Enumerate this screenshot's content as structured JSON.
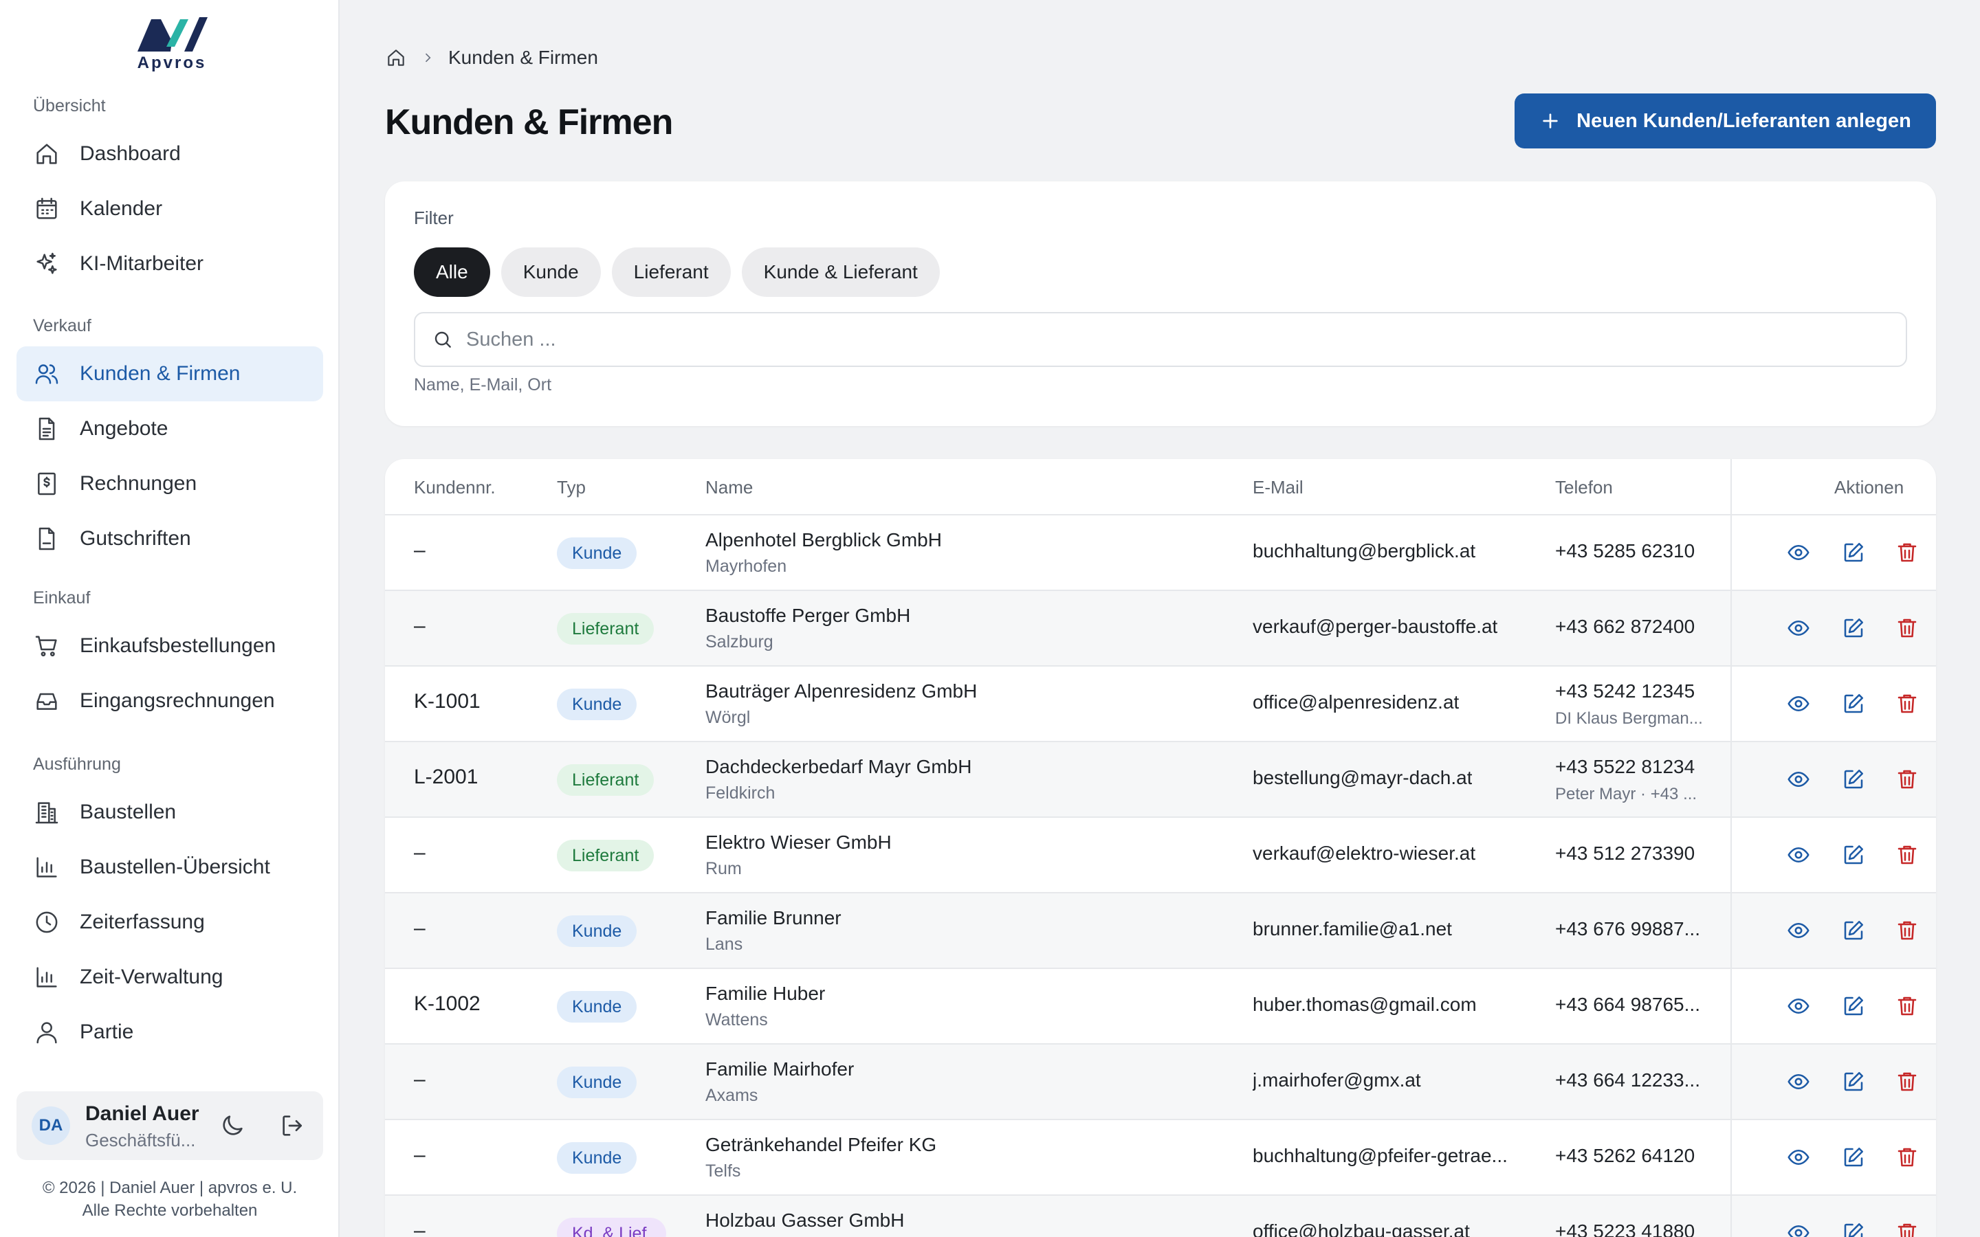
{
  "app": {
    "logo_text": "Apvros"
  },
  "sidebar": {
    "sections": [
      {
        "label": "Übersicht",
        "items": [
          {
            "label": "Dashboard",
            "icon": "home-icon"
          },
          {
            "label": "Kalender",
            "icon": "calendar-icon"
          },
          {
            "label": "KI-Mitarbeiter",
            "icon": "sparkles-icon"
          }
        ]
      },
      {
        "label": "Verkauf",
        "items": [
          {
            "label": "Kunden & Firmen",
            "icon": "users-icon",
            "active": true
          },
          {
            "label": "Angebote",
            "icon": "document-icon"
          },
          {
            "label": "Rechnungen",
            "icon": "invoice-icon"
          },
          {
            "label": "Gutschriften",
            "icon": "file-icon"
          }
        ]
      },
      {
        "label": "Einkauf",
        "items": [
          {
            "label": "Einkaufsbestellungen",
            "icon": "cart-icon"
          },
          {
            "label": "Eingangsrechnungen",
            "icon": "inbox-icon"
          }
        ]
      },
      {
        "label": "Ausführung",
        "items": [
          {
            "label": "Baustellen",
            "icon": "building-icon"
          },
          {
            "label": "Baustellen-Übersicht",
            "icon": "bar-chart-icon"
          },
          {
            "label": "Zeiterfassung",
            "icon": "clock-icon"
          },
          {
            "label": "Zeit-Verwaltung",
            "icon": "bar-chart-icon"
          },
          {
            "label": "Partie",
            "icon": "user-icon"
          }
        ]
      }
    ]
  },
  "user": {
    "initials": "DA",
    "name": "Daniel Auer",
    "role": "Geschäftsfü..."
  },
  "footer": {
    "line1": "© 2026 | Daniel Auer | apvros e. U.",
    "line2": "Alle Rechte vorbehalten"
  },
  "breadcrumb": {
    "current": "Kunden & Firmen"
  },
  "page": {
    "title": "Kunden & Firmen",
    "create_button": "Neuen Kunden/Lieferanten anlegen"
  },
  "filter": {
    "label": "Filter",
    "chips": [
      "Alle",
      "Kunde",
      "Lieferant",
      "Kunde & Lieferant"
    ],
    "active_chip": "Alle",
    "search_placeholder": "Suchen ...",
    "search_value": "",
    "search_hint": "Name, E-Mail, Ort"
  },
  "table": {
    "headers": {
      "knr": "Kundennr.",
      "typ": "Typ",
      "name": "Name",
      "email": "E-Mail",
      "telefon": "Telefon",
      "aktionen": "Aktionen"
    },
    "rows": [
      {
        "knr": "–",
        "typ": "Kunde",
        "typ_kind": "kunde",
        "name": "Alpenhotel Bergblick GmbH",
        "ort": "Mayrhofen",
        "email": "buchhaltung@bergblick.at",
        "telefon": "+43 5285 62310",
        "kontakt": ""
      },
      {
        "knr": "–",
        "typ": "Lieferant",
        "typ_kind": "lieferant",
        "name": "Baustoffe Perger GmbH",
        "ort": "Salzburg",
        "email": "verkauf@perger-baustoffe.at",
        "telefon": "+43 662 872400",
        "kontakt": ""
      },
      {
        "knr": "K-1001",
        "typ": "Kunde",
        "typ_kind": "kunde",
        "name": "Bauträger Alpenresidenz GmbH",
        "ort": "Wörgl",
        "email": "office@alpenresidenz.at",
        "telefon": "+43 5242 12345",
        "kontakt": "DI Klaus Bergman..."
      },
      {
        "knr": "L-2001",
        "typ": "Lieferant",
        "typ_kind": "lieferant",
        "name": "Dachdeckerbedarf Mayr GmbH",
        "ort": "Feldkirch",
        "email": "bestellung@mayr-dach.at",
        "telefon": "+43 5522 81234",
        "kontakt": "Peter Mayr · +43 ..."
      },
      {
        "knr": "–",
        "typ": "Lieferant",
        "typ_kind": "lieferant",
        "name": "Elektro Wieser GmbH",
        "ort": "Rum",
        "email": "verkauf@elektro-wieser.at",
        "telefon": "+43 512 273390",
        "kontakt": ""
      },
      {
        "knr": "–",
        "typ": "Kunde",
        "typ_kind": "kunde",
        "name": "Familie Brunner",
        "ort": "Lans",
        "email": "brunner.familie@a1.net",
        "telefon": "+43 676 99887...",
        "kontakt": ""
      },
      {
        "knr": "K-1002",
        "typ": "Kunde",
        "typ_kind": "kunde",
        "name": "Familie Huber",
        "ort": "Wattens",
        "email": "huber.thomas@gmail.com",
        "telefon": "+43 664 98765...",
        "kontakt": ""
      },
      {
        "knr": "–",
        "typ": "Kunde",
        "typ_kind": "kunde",
        "name": "Familie Mairhofer",
        "ort": "Axams",
        "email": "j.mairhofer@gmx.at",
        "telefon": "+43 664 12233...",
        "kontakt": ""
      },
      {
        "knr": "–",
        "typ": "Kunde",
        "typ_kind": "kunde",
        "name": "Getränkehandel Pfeifer KG",
        "ort": "Telfs",
        "email": "buchhaltung@pfeifer-getrae...",
        "telefon": "+43 5262 64120",
        "kontakt": ""
      },
      {
        "knr": "–",
        "typ": "Kd. & Lief.",
        "typ_kind": "both",
        "name": "Holzbau Gasser GmbH",
        "ort": "",
        "email": "office@holzbau-gasser.at",
        "telefon": "+43 5223 41880",
        "kontakt": ""
      }
    ]
  },
  "colors": {
    "accent": "#1c5aa6",
    "danger": "#c62828",
    "active_nav_bg": "#e8f1fb"
  }
}
